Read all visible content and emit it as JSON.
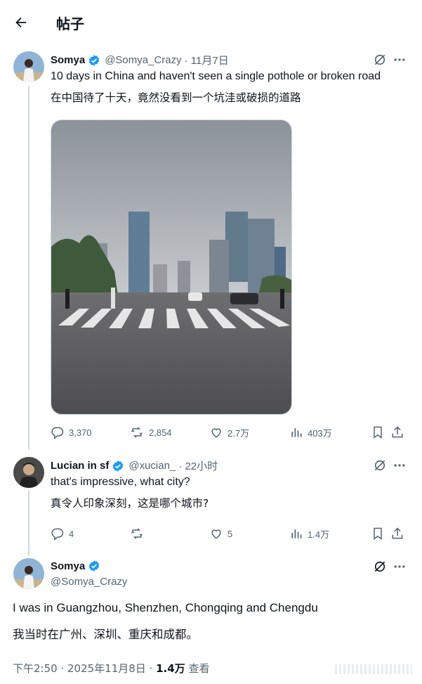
{
  "header": {
    "title": "帖子"
  },
  "tweet1": {
    "name": "Somya",
    "handle": "@Somya_Crazy",
    "date": "· 11月7日",
    "text_en": "10 days in China and haven't seen a single pothole or broken road",
    "text_cn": "在中国待了十天，竟然没看到一个坑洼或破损的道路",
    "replies": "3,370",
    "reposts": "2,854",
    "likes": "2.7万",
    "views": "403万"
  },
  "tweet2": {
    "name": "Lucian in sf",
    "handle": "@xucian_",
    "date": "· 22小时",
    "text_en": "that's impressive, what city?",
    "text_cn": "真令人印象深刻，这是哪个城市?",
    "replies": "4",
    "reposts": "",
    "likes": "5",
    "views": "1.4万"
  },
  "tweet3": {
    "name": "Somya",
    "handle": "@Somya_Crazy",
    "text_en": "I was in Guangzhou, Shenzhen, Chongqing and Chengdu",
    "text_cn": "我当时在广州、深圳、重庆和成都。",
    "time": "下午2:50 · 2025年11月8日 · ",
    "views": "1.4万",
    "views_label": " 查看"
  },
  "colors": {
    "verified": "#1d9bf0",
    "icon_gray": "#536471",
    "text": "#0f1419"
  },
  "icons": [
    "back-arrow-icon",
    "verified-icon",
    "grok-icon",
    "more-icon",
    "reply-icon",
    "repost-icon",
    "like-icon",
    "views-icon",
    "bookmark-icon",
    "share-icon"
  ]
}
